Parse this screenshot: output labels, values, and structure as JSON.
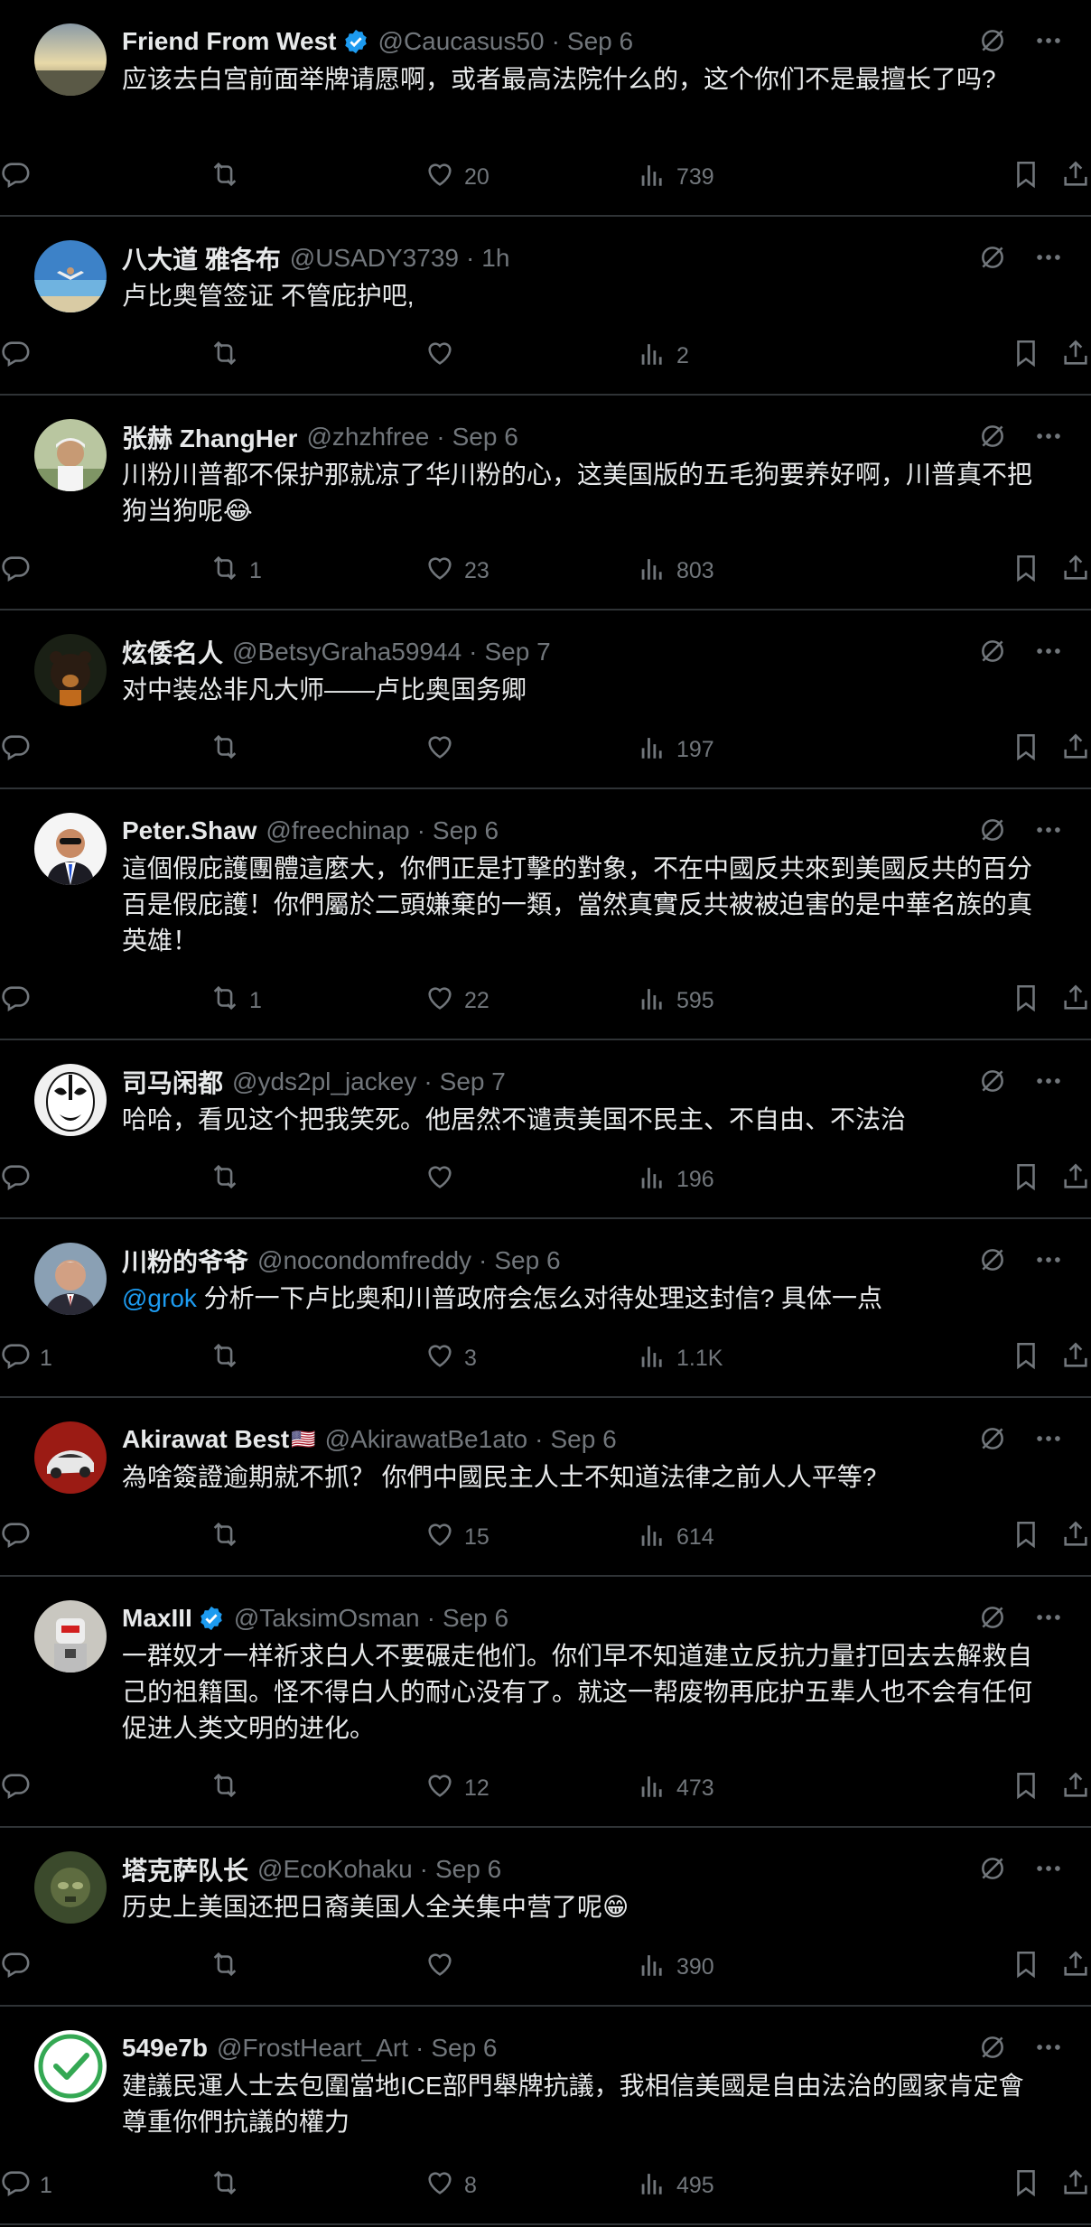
{
  "tweets": [
    {
      "name": "Friend From West",
      "verified": true,
      "flag": "",
      "handle": "@Caucasus50",
      "time": "Sep 6",
      "text": "应该去白宫前面举牌请愿啊，或者最高法院什么的，这个你们不是最擅长了吗?",
      "mention": "",
      "replies": "",
      "reposts": "",
      "likes": "20",
      "views": "739",
      "avatar": "sky"
    },
    {
      "name": "八大道 雅各布",
      "verified": false,
      "flag": "",
      "handle": "@USADY3739",
      "time": "1h",
      "text": "卢比奥管签证 不管庇护吧,",
      "mention": "",
      "replies": "",
      "reposts": "",
      "likes": "",
      "views": "2",
      "avatar": "beach"
    },
    {
      "name": "张赫 ZhangHer",
      "verified": false,
      "flag": "",
      "handle": "@zhzhfree",
      "time": "Sep 6",
      "text": "川粉川普都不保护那就凉了华川粉的心，这美国版的五毛狗要养好啊，川普真不把狗当狗呢😂",
      "mention": "",
      "replies": "",
      "reposts": "1",
      "likes": "23",
      "views": "803",
      "avatar": "person"
    },
    {
      "name": "炫倭名人",
      "verified": false,
      "flag": "",
      "handle": "@BetsyGraha59944",
      "time": "Sep 7",
      "text": "对中装怂非凡大师——卢比奥国务卿",
      "mention": "",
      "replies": "",
      "reposts": "",
      "likes": "",
      "views": "197",
      "avatar": "bear"
    },
    {
      "name": "Peter.Shaw",
      "verified": false,
      "flag": "",
      "handle": "@freechinap",
      "time": "Sep 6",
      "text": "這個假庇護團體這麼大，你們正是打擊的對象，不在中國反共來到美國反共的百分百是假庇護！你們屬於二頭嫌棄的一類，當然真實反共被被迫害的是中華名族的真英雄！",
      "mention": "",
      "replies": "",
      "reposts": "1",
      "likes": "22",
      "views": "595",
      "avatar": "suit"
    },
    {
      "name": "司马闲都",
      "verified": false,
      "flag": "",
      "handle": "@yds2pl_jackey",
      "time": "Sep 7",
      "text": "哈哈，看见这个把我笑死。他居然不谴责美国不民主、不自由、不法治",
      "mention": "",
      "replies": "",
      "reposts": "",
      "likes": "",
      "views": "196",
      "avatar": "opera"
    },
    {
      "name": "川粉的爷爷",
      "verified": false,
      "flag": "",
      "handle": "@nocondomfreddy",
      "time": "Sep 6",
      "text": " 分析一下卢比奥和川普政府会怎么对待处理这封信? 具体一点",
      "mention": "@grok",
      "replies": "1",
      "reposts": "",
      "likes": "3",
      "views": "1.1K",
      "avatar": "oldman"
    },
    {
      "name": "Akirawat Best",
      "verified": false,
      "flag": "🇺🇸",
      "handle": "@AkirawatBe1ato",
      "time": "Sep 6",
      "text": "為啥簽證逾期就不抓？ 你們中國民主人士不知道法律之前人人平等?",
      "mention": "",
      "replies": "",
      "reposts": "",
      "likes": "15",
      "views": "614",
      "avatar": "car"
    },
    {
      "name": "MaxIII",
      "verified": true,
      "flag": "",
      "handle": "@TaksimOsman",
      "time": "Sep 6",
      "text": "一群奴才一样祈求白人不要碾走他们。你们早不知道建立反抗力量打回去去解救自己的祖籍国。怪不得白人的耐心没有了。就这一帮废物再庇护五辈人也不会有任何促进人类文明的进化。",
      "mention": "",
      "replies": "",
      "reposts": "",
      "likes": "12",
      "views": "473",
      "avatar": "robot"
    },
    {
      "name": "塔克萨队长",
      "verified": false,
      "flag": "",
      "handle": "@EcoKohaku",
      "time": "Sep 6",
      "text": "历史上美国还把日裔美国人全关集中营了呢😁",
      "mention": "",
      "replies": "",
      "reposts": "",
      "likes": "",
      "views": "390",
      "avatar": "soldier"
    },
    {
      "name": "549e7b",
      "verified": false,
      "flag": "",
      "handle": "@FrostHeart_Art",
      "time": "Sep 6",
      "text": "建議民運人士去包圍當地ICE部門舉牌抗議，我相信美國是自由法治的國家肯定會尊重你們抗議的權力",
      "mention": "",
      "replies": "1",
      "reposts": "",
      "likes": "8",
      "views": "495",
      "avatar": "check"
    }
  ],
  "icons": {
    "reply": "reply-icon",
    "repost": "repost-icon",
    "like": "heart-icon",
    "views": "views-icon",
    "bookmark": "bookmark-icon",
    "share": "share-icon",
    "grok": "grok-icon",
    "more": "more-icon",
    "verified": "verified-badge-icon"
  },
  "colors": {
    "background": "#000000",
    "text": "#e7e9ea",
    "muted": "#71767b",
    "accent": "#1d9bf0",
    "divider": "#2f3336"
  }
}
